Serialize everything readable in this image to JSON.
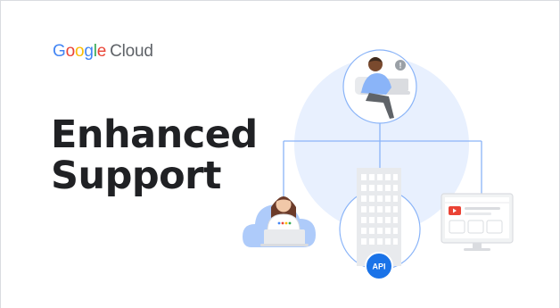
{
  "brand": {
    "logo_google_letters": [
      "G",
      "o",
      "o",
      "g",
      "l",
      "e"
    ],
    "logo_product": "Cloud"
  },
  "headline": {
    "line1": "Enhanced",
    "line2": "Support"
  },
  "illustration": {
    "api_badge": "API",
    "alert_glyph": "!"
  },
  "colors": {
    "circle_light_blue": "#d2e3fc",
    "line_blue": "#8ab4f8",
    "api_blue": "#4285f4",
    "building_gray": "#dadce0",
    "text_dark": "#202124"
  }
}
